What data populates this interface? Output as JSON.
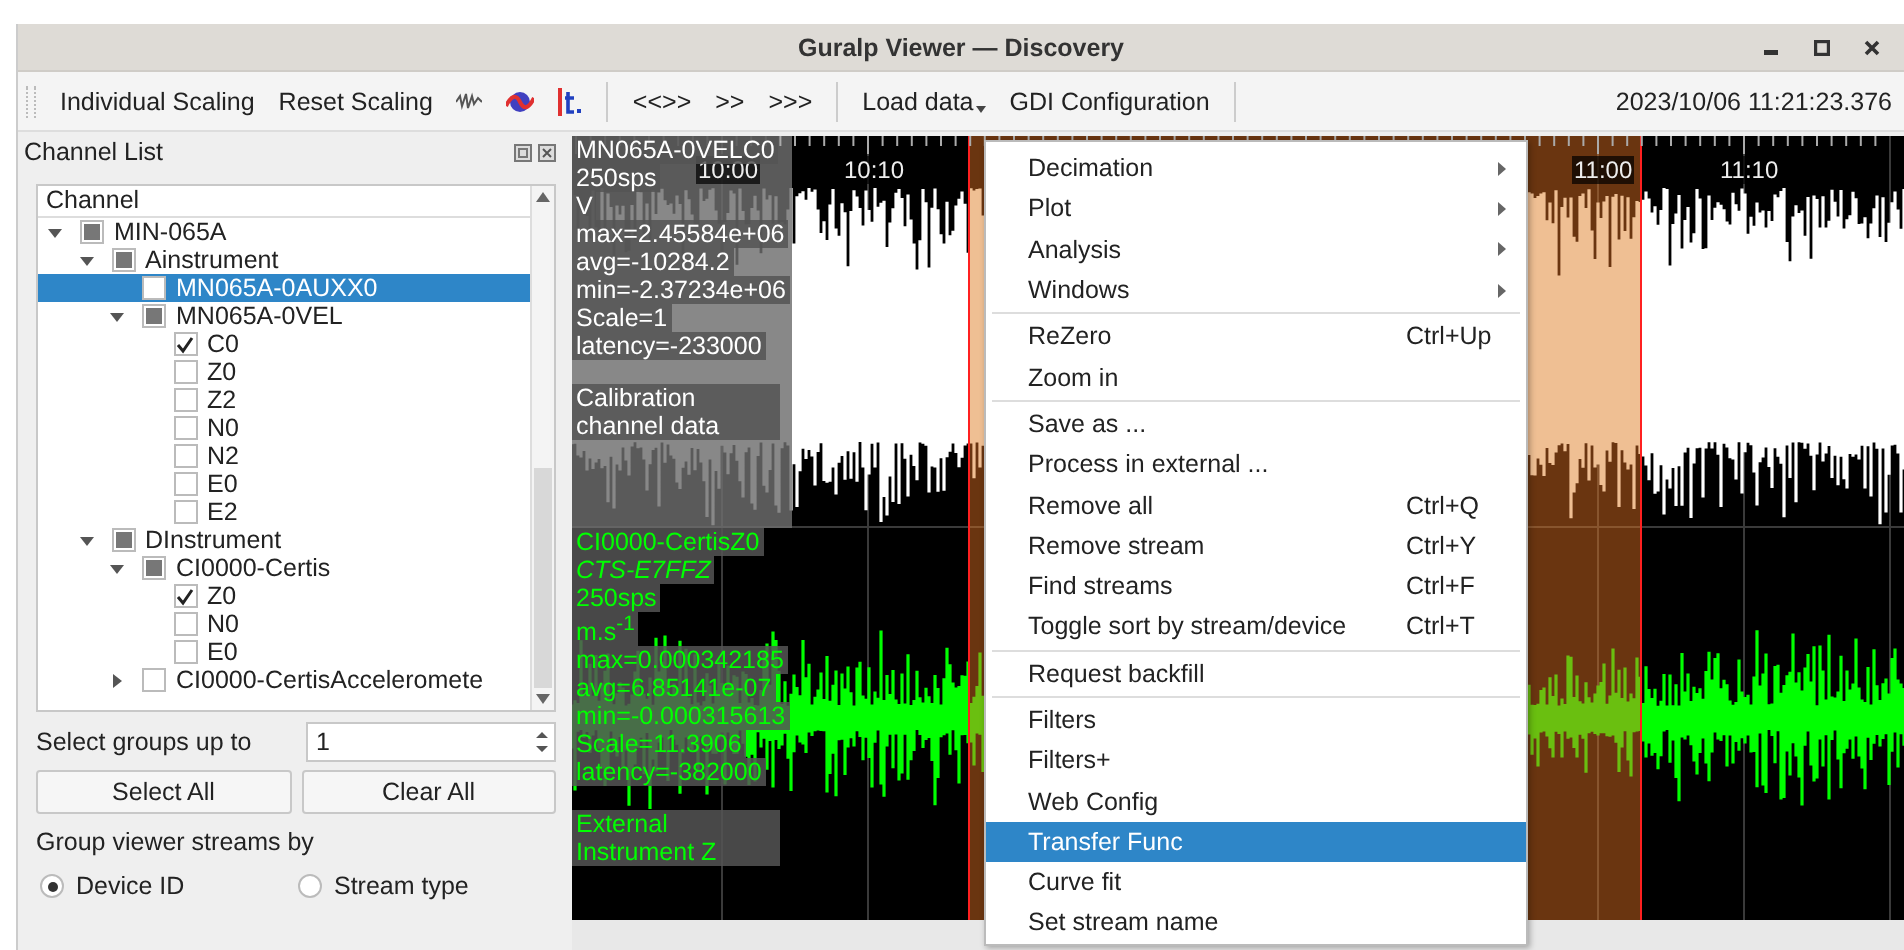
{
  "window": {
    "title": "Guralp Viewer — Discovery"
  },
  "toolbar": {
    "scaling_buttons": [
      "Individual Scaling",
      "Reset Scaling"
    ],
    "navigation_buttons": [
      "<<>>",
      ">>",
      ">>>"
    ],
    "menu_buttons": [
      {
        "label": "Load data",
        "dropdown": true
      },
      {
        "label": "GDI Configuration",
        "dropdown": false
      }
    ],
    "timestamp": "2023/10/06 11:21:23.376"
  },
  "channel_list": {
    "title": "Channel List",
    "tree": {
      "header": "Channel",
      "items": [
        {
          "kind": "group",
          "label": "MIN-065A",
          "expanded": true,
          "partial": true,
          "selected": false,
          "children": [
            {
              "kind": "group",
              "label": "Ainstrument",
              "expanded": true,
              "partial": true,
              "selected": false,
              "children": [
                {
                  "kind": "channel",
                  "label": "MN065A-0AUXX0",
                  "checked": false,
                  "selected": true
                },
                {
                  "kind": "group",
                  "label": "MN065A-0VEL",
                  "expanded": true,
                  "partial": true,
                  "selected": false,
                  "children": [
                    {
                      "kind": "channel",
                      "label": "C0",
                      "checked": true,
                      "selected": false
                    },
                    {
                      "kind": "channel",
                      "label": "Z0",
                      "checked": false,
                      "selected": false
                    },
                    {
                      "kind": "channel",
                      "label": "Z2",
                      "checked": false,
                      "selected": false
                    },
                    {
                      "kind": "channel",
                      "label": "N0",
                      "checked": false,
                      "selected": false
                    },
                    {
                      "kind": "channel",
                      "label": "N2",
                      "checked": false,
                      "selected": false
                    },
                    {
                      "kind": "channel",
                      "label": "E0",
                      "checked": false,
                      "selected": false
                    },
                    {
                      "kind": "channel",
                      "label": "E2",
                      "checked": false,
                      "selected": false
                    }
                  ]
                }
              ]
            },
            {
              "kind": "group",
              "label": "DInstrument",
              "expanded": true,
              "partial": true,
              "selected": false,
              "children": [
                {
                  "kind": "group",
                  "label": "CI0000-Certis",
                  "expanded": true,
                  "partial": true,
                  "selected": false,
                  "children": [
                    {
                      "kind": "channel",
                      "label": "Z0",
                      "checked": true,
                      "selected": false
                    },
                    {
                      "kind": "channel",
                      "label": "N0",
                      "checked": false,
                      "selected": false
                    },
                    {
                      "kind": "channel",
                      "label": "E0",
                      "checked": false,
                      "selected": false
                    }
                  ]
                },
                {
                  "kind": "group",
                  "label": "CI0000-CertisAcceleromete",
                  "expanded": false,
                  "partial": false,
                  "selected": false
                }
              ]
            }
          ]
        }
      ]
    },
    "select_groups": {
      "label": "Select groups up to",
      "value": "1"
    },
    "buttons": [
      "Select All",
      "Clear All"
    ],
    "group_by": {
      "label": "Group viewer streams by",
      "options": [
        {
          "label": "Device ID",
          "selected": true
        },
        {
          "label": "Stream type",
          "selected": false
        }
      ]
    }
  },
  "plot": {
    "time_labels": [
      "10:00",
      "10:10",
      "11:00",
      "11:10"
    ],
    "traces": [
      {
        "color": "#ffffff",
        "highlighted": true,
        "name": "MN065A-0VELC0",
        "rate": "250sps",
        "unit": "V",
        "stats": [
          "max=2.45584e+06",
          "avg=-10284.2",
          "min=-2.37234e+06",
          "Scale=1",
          "latency=-233000"
        ],
        "description": "Calibration channel data"
      },
      {
        "color": "#00ff00",
        "highlighted": false,
        "name": "CI0000-CertisZ0",
        "serial": "CTS-E7FFZ",
        "rate": "250sps",
        "unit": "m.s$^{-1}$",
        "stats": [
          "max=0.000342185",
          "avg=6.85141e-07",
          "min=-0.000315613",
          "Scale=11.3906",
          "latency=-382000"
        ],
        "description": "External Instrument Z"
      }
    ]
  },
  "context_menu": {
    "sections": [
      [
        {
          "label": "Decimation",
          "submenu": true,
          "selected": false
        },
        {
          "label": "Plot",
          "submenu": true,
          "selected": false
        },
        {
          "label": "Analysis",
          "submenu": true,
          "selected": false
        },
        {
          "label": "Windows",
          "submenu": true,
          "selected": false
        }
      ],
      [
        {
          "label": "ReZero",
          "shortcut": "Ctrl+Up",
          "submenu": false,
          "selected": false
        },
        {
          "label": "Zoom in",
          "submenu": false,
          "selected": false
        }
      ],
      [
        {
          "label": "Save as ...",
          "submenu": false,
          "selected": false
        },
        {
          "label": "Process in external ...",
          "submenu": false,
          "selected": false
        },
        {
          "label": "Remove all",
          "shortcut": "Ctrl+Q",
          "submenu": false,
          "selected": false
        },
        {
          "label": "Remove stream",
          "shortcut": "Ctrl+Y",
          "submenu": false,
          "selected": false
        },
        {
          "label": "Find streams",
          "shortcut": "Ctrl+F",
          "submenu": false,
          "selected": false
        },
        {
          "label": "Toggle sort by stream/device",
          "shortcut": "Ctrl+T",
          "submenu": false,
          "selected": false
        }
      ],
      [
        {
          "label": "Request backfill",
          "submenu": false,
          "selected": false
        }
      ],
      [
        {
          "label": "Filters",
          "submenu": false,
          "selected": false
        },
        {
          "label": "Filters+",
          "submenu": false,
          "selected": false
        },
        {
          "label": "Web Config",
          "submenu": false,
          "selected": false
        },
        {
          "label": "Transfer Func",
          "submenu": false,
          "selected": true
        },
        {
          "label": "Curve fit",
          "submenu": false,
          "selected": false
        },
        {
          "label": "Set stream name",
          "submenu": false,
          "selected": false
        }
      ]
    ]
  }
}
